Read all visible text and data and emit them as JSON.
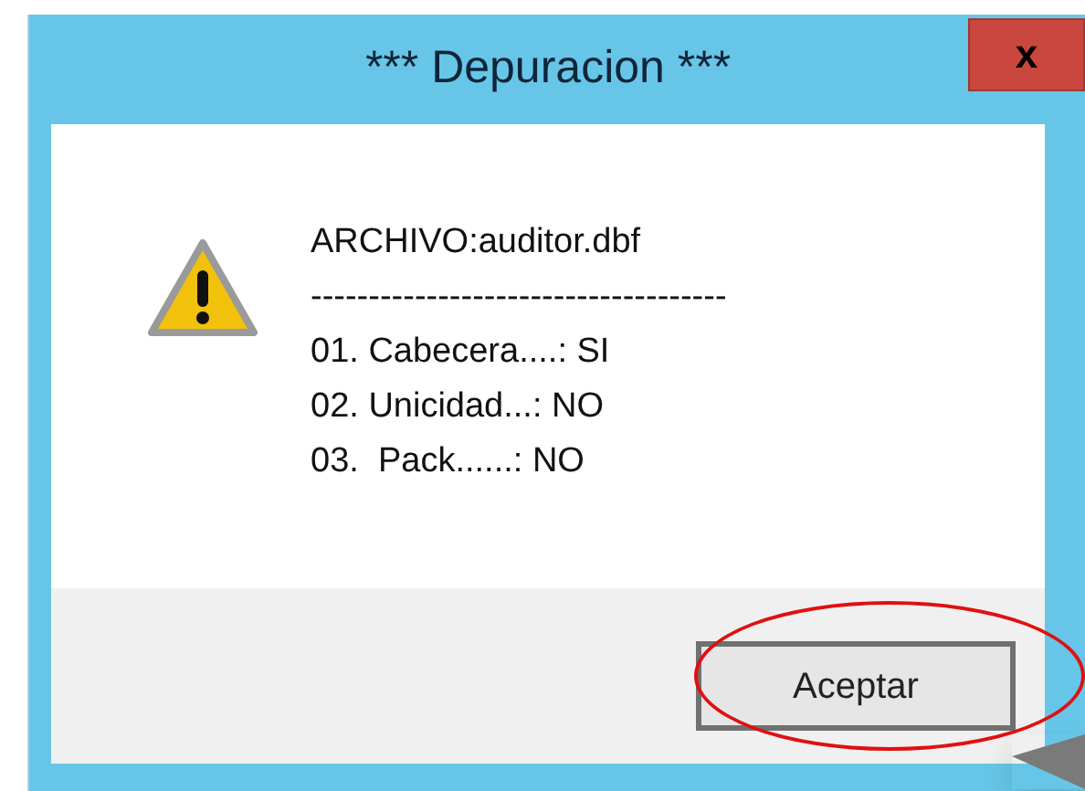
{
  "window": {
    "title": "*** Depuracion ***",
    "close_label": "x"
  },
  "message": {
    "lines": [
      "ARCHIVO:auditor.dbf",
      "------------------------------------",
      "01. Cabecera....: SI",
      "02. Unicidad...: NO",
      "03.  Pack......: NO"
    ]
  },
  "buttons": [
    {
      "label": "Aceptar",
      "highlighted": true
    }
  ]
}
